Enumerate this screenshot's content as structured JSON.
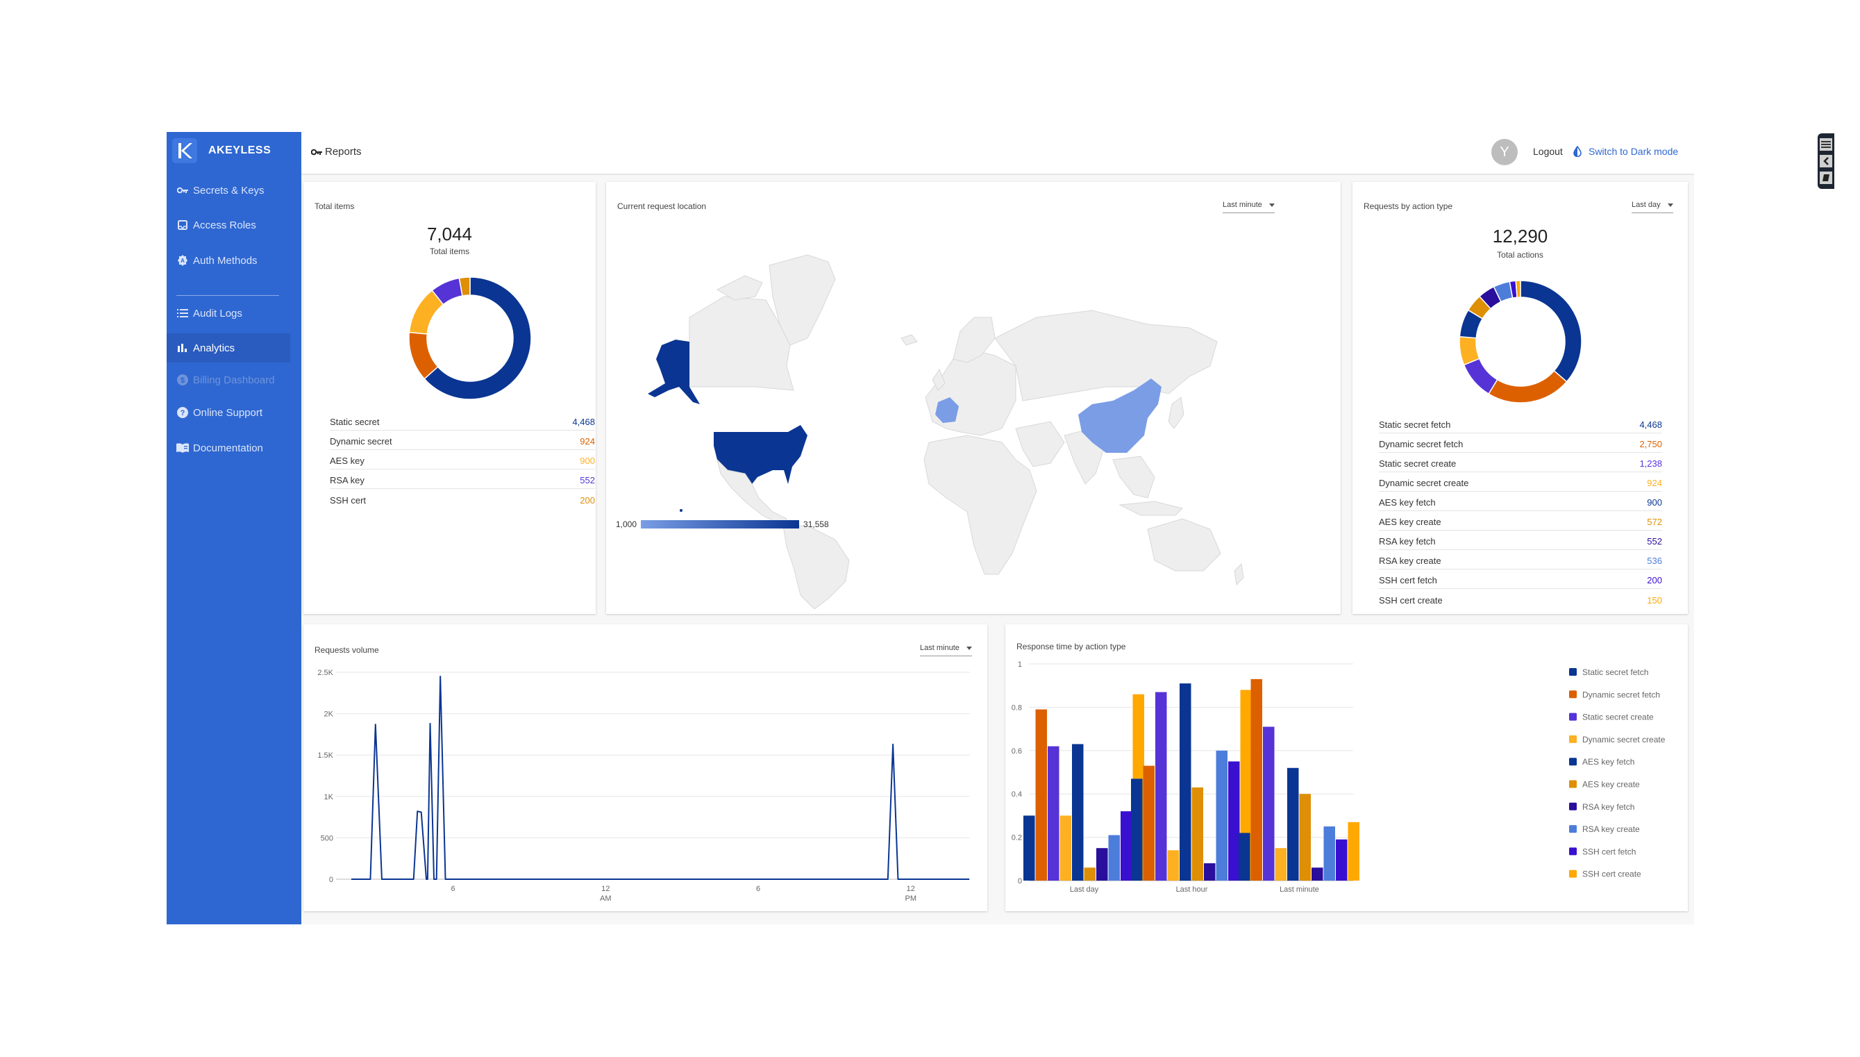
{
  "sidebar": {
    "brand": "AKEYLESS",
    "items": [
      {
        "label": "Secrets & Keys",
        "icon": "key-icon",
        "state": "normal"
      },
      {
        "label": "Access Roles",
        "icon": "inbox-icon",
        "state": "normal"
      },
      {
        "label": "Auth Methods",
        "icon": "badge-icon",
        "state": "normal"
      },
      {
        "label": "Audit Logs",
        "icon": "list-icon",
        "state": "normal"
      },
      {
        "label": "Analytics",
        "icon": "bar-chart-icon",
        "state": "active"
      },
      {
        "label": "Billing Dashboard",
        "icon": "dollar-icon",
        "state": "disabled"
      },
      {
        "label": "Online Support",
        "icon": "help-icon",
        "state": "normal"
      },
      {
        "label": "Documentation",
        "icon": "book-icon",
        "state": "normal"
      }
    ]
  },
  "header": {
    "title": "Reports",
    "avatar_initial": "Y",
    "logout": "Logout",
    "dark_mode": "Switch to Dark mode"
  },
  "colors": {
    "sidebar": "#2e67d1",
    "accent": "#2e67d1",
    "palette": [
      "#0a3592",
      "#dc6000",
      "#5533d7",
      "#fdb022",
      "#0a3592",
      "#de8f06",
      "#2a0e9c",
      "#4d7ddb",
      "#3910d0",
      "#ffa800"
    ]
  },
  "total_items": {
    "title": "Total items",
    "total": "7,044",
    "total_label": "Total items",
    "items": [
      {
        "label": "Static secret",
        "value": 4468,
        "display": "4,468",
        "color": "#0a3592"
      },
      {
        "label": "Dynamic secret",
        "value": 924,
        "display": "924",
        "color": "#dc6000"
      },
      {
        "label": "AES key",
        "value": 900,
        "display": "900",
        "color": "#fdb022"
      },
      {
        "label": "RSA key",
        "value": 552,
        "display": "552",
        "color": "#5533d7"
      },
      {
        "label": "SSH cert",
        "value": 200,
        "display": "200",
        "color": "#de8f06"
      }
    ]
  },
  "map": {
    "title": "Current request location",
    "range": "Last minute",
    "legend_min": "1,000",
    "legend_max": "31,558",
    "highlighted": [
      {
        "country": "United States",
        "level": "high"
      },
      {
        "country": "France",
        "level": "low"
      },
      {
        "country": "China",
        "level": "low"
      }
    ]
  },
  "requests_by_action": {
    "title": "Requests by action type",
    "range": "Last day",
    "total": "12,290",
    "total_label": "Total actions",
    "items": [
      {
        "label": "Static secret fetch",
        "value": 4468,
        "display": "4,468",
        "color": "#0a3592"
      },
      {
        "label": "Dynamic secret fetch",
        "value": 2750,
        "display": "2,750",
        "color": "#dc6000"
      },
      {
        "label": "Static secret create",
        "value": 1238,
        "display": "1,238",
        "color": "#5533d7"
      },
      {
        "label": "Dynamic secret create",
        "value": 924,
        "display": "924",
        "color": "#fdb022"
      },
      {
        "label": "AES key fetch",
        "value": 900,
        "display": "900",
        "color": "#0a3592"
      },
      {
        "label": "AES key create",
        "value": 572,
        "display": "572",
        "color": "#de8f06"
      },
      {
        "label": "RSA key fetch",
        "value": 552,
        "display": "552",
        "color": "#2a0e9c"
      },
      {
        "label": "RSA key create",
        "value": 536,
        "display": "536",
        "color": "#4d7ddb"
      },
      {
        "label": "SSH cert fetch",
        "value": 200,
        "display": "200",
        "color": "#3910d0"
      },
      {
        "label": "SSH cert create",
        "value": 150,
        "display": "150",
        "color": "#ffa800"
      }
    ]
  },
  "chart_data": [
    {
      "type": "line",
      "title": "Requests volume",
      "range": "Last minute",
      "xlabel": "",
      "ylabel": "",
      "x_hours": [
        2.0,
        2.75,
        2.95,
        3.2,
        4.45,
        4.6,
        4.75,
        4.95,
        5.0,
        5.1,
        5.25,
        5.35,
        5.5,
        5.7,
        23.1,
        23.3,
        23.5,
        26.3
      ],
      "values": [
        0,
        0,
        1870,
        0,
        0,
        820,
        810,
        0,
        0,
        1880,
        0,
        0,
        2450,
        0,
        0,
        1630,
        0,
        0
      ],
      "xlim": [
        2.0,
        26.3
      ],
      "ylim": [
        0,
        2500
      ],
      "yticks": [
        {
          "v": 0,
          "label": "0"
        },
        {
          "v": 500,
          "label": "500"
        },
        {
          "v": 1000,
          "label": "1K"
        },
        {
          "v": 1500,
          "label": "1.5K"
        },
        {
          "v": 2000,
          "label": "2K"
        },
        {
          "v": 2500,
          "label": "2.5K"
        }
      ],
      "xticks": [
        {
          "v": 6,
          "label": "6",
          "sub": ""
        },
        {
          "v": 12,
          "label": "12",
          "sub": "AM"
        },
        {
          "v": 18,
          "label": "6",
          "sub": ""
        },
        {
          "v": 24,
          "label": "12",
          "sub": "PM"
        }
      ],
      "grid": true,
      "color": "#0a3592"
    },
    {
      "type": "bar",
      "title": "Response time by action type",
      "categories": [
        "Last day",
        "Last hour",
        "Last minute"
      ],
      "ylim": [
        0,
        1
      ],
      "yticks": [
        "0",
        "0.2",
        "0.4",
        "0.6",
        "0.8",
        "1"
      ],
      "grid": true,
      "legend": "right",
      "series": [
        {
          "name": "Static secret fetch",
          "color": "#0a3592",
          "values": [
            0.3,
            0.47,
            0.22
          ]
        },
        {
          "name": "Dynamic secret fetch",
          "color": "#dc6000",
          "values": [
            0.79,
            0.53,
            0.93
          ]
        },
        {
          "name": "Static secret create",
          "color": "#5533d7",
          "values": [
            0.62,
            0.87,
            0.71
          ]
        },
        {
          "name": "Dynamic secret create",
          "color": "#fdb022",
          "values": [
            0.3,
            0.14,
            0.15
          ]
        },
        {
          "name": "AES key fetch",
          "color": "#0a3592",
          "values": [
            0.63,
            0.91,
            0.52
          ]
        },
        {
          "name": "AES key create",
          "color": "#de8f06",
          "values": [
            0.06,
            0.43,
            0.4
          ]
        },
        {
          "name": "RSA key fetch",
          "color": "#2a0e9c",
          "values": [
            0.15,
            0.08,
            0.06
          ]
        },
        {
          "name": "RSA key create",
          "color": "#4d7ddb",
          "values": [
            0.21,
            0.6,
            0.25
          ]
        },
        {
          "name": "SSH cert fetch",
          "color": "#3910d0",
          "values": [
            0.32,
            0.55,
            0.19
          ]
        },
        {
          "name": "SSH cert create",
          "color": "#ffa800",
          "values": [
            0.86,
            0.88,
            0.27
          ]
        }
      ]
    }
  ]
}
